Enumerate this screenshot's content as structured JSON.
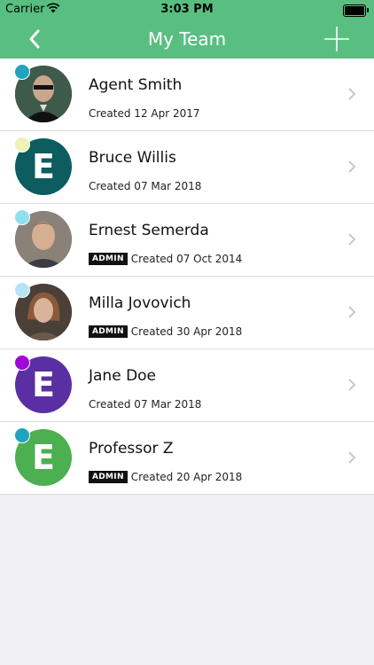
{
  "status_bar": {
    "carrier": "Carrier",
    "time": "3:03 PM"
  },
  "nav": {
    "title": "My Team",
    "back_icon": "chevron-left-icon",
    "add_icon": "plus-icon"
  },
  "colors": {
    "header": "#58bf80",
    "background": "#efeff4"
  },
  "members": [
    {
      "name": "Agent Smith",
      "created": "Created 12 Apr 2017",
      "admin": false,
      "avatar": "photo",
      "status_color": "#1fa3bf"
    },
    {
      "name": "Bruce Willis",
      "created": "Created 07 Mar 2018",
      "admin": false,
      "avatar": "E",
      "avatar_color": "#0d5c5f",
      "status_color": "#eff2b8"
    },
    {
      "name": "Ernest Semerda",
      "created": "Created 07 Oct 2014",
      "admin": true,
      "badge": "ADMIN",
      "avatar": "photo",
      "status_color": "#8fe0ee"
    },
    {
      "name": "Milla Jovovich",
      "created": "Created 30 Apr 2018",
      "admin": true,
      "badge": "ADMIN",
      "avatar": "photo",
      "status_color": "#b6e3f6"
    },
    {
      "name": "Jane Doe",
      "created": "Created 07 Mar 2018",
      "admin": false,
      "avatar": "E",
      "avatar_color": "#5b2fa4",
      "status_color": "#a106d8"
    },
    {
      "name": "Professor Z",
      "created": "Created 20 Apr 2018",
      "admin": true,
      "badge": "ADMIN",
      "avatar": "E",
      "avatar_color": "#4caf50",
      "status_color": "#1fa3bf"
    }
  ]
}
